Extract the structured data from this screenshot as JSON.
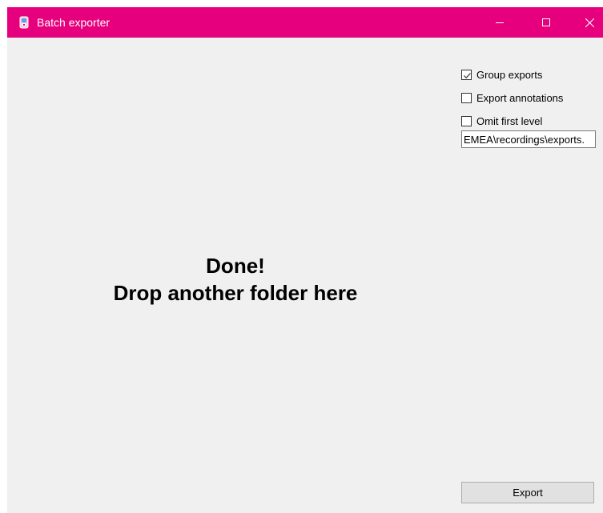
{
  "window": {
    "title": "Batch exporter",
    "title_bar_color": "#e6007e",
    "icon": "batch-exporter-app-icon",
    "controls": {
      "minimize_icon": "minimize-icon",
      "maximize_icon": "maximize-icon",
      "close_icon": "close-icon"
    }
  },
  "options": {
    "group_exports": {
      "label": "Group exports",
      "checked": true
    },
    "export_annotations": {
      "label": "Export annotations",
      "checked": false
    },
    "omit_first_level": {
      "label": "Omit first level",
      "checked": false
    }
  },
  "output_path": {
    "value": ".EMEA\\recordings\\exports"
  },
  "drop_zone": {
    "line1": "Done!",
    "line2": "Drop another folder here"
  },
  "export_button": {
    "label": "Export"
  }
}
